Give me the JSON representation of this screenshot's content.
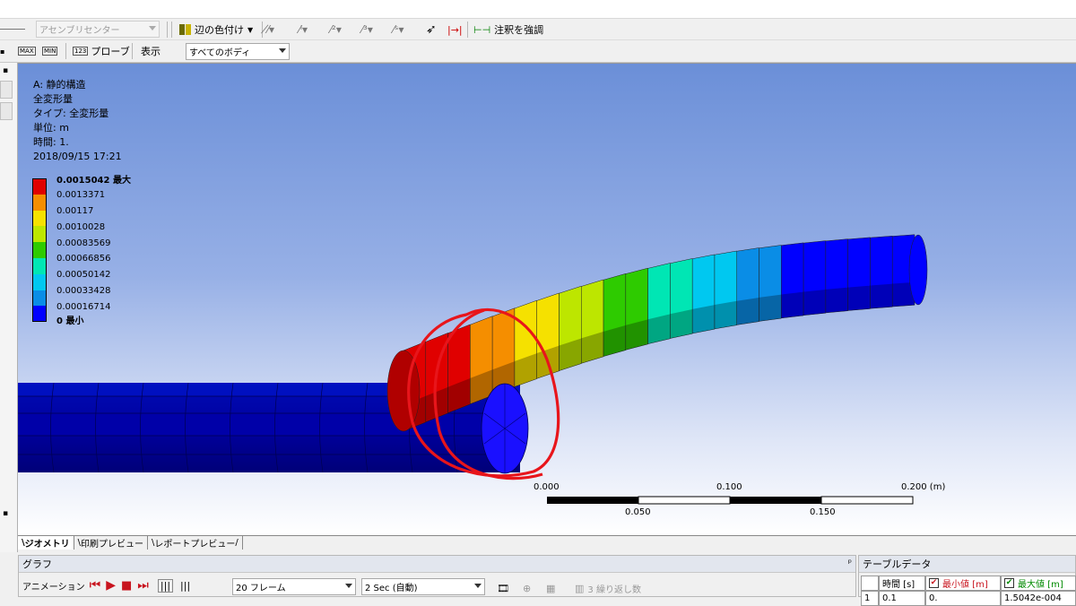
{
  "toolbar1": {
    "assembly_center": "アセンブリセンター",
    "edge_color": "辺の色付け",
    "annotation_emphasis": "注釈を強調"
  },
  "toolbar2": {
    "max_label": "MAX",
    "min_label": "MIN",
    "probe": "プローブ",
    "display": "表示",
    "body_select": "すべてのボディ"
  },
  "result_info": {
    "line1": "A: 静的構造",
    "line2": "全変形量",
    "line3": "タイプ: 全変形量",
    "line4": "単位: m",
    "line5": "時間: 1.",
    "line6": "2018/09/15 17:21"
  },
  "legend": {
    "colors": [
      "#e00000",
      "#f58e00",
      "#f5e100",
      "#bde600",
      "#2ecb00",
      "#00e6b4",
      "#00c8f0",
      "#0a8de6",
      "#0000ff"
    ],
    "labels": [
      "0.0015042 最大",
      "0.0013371",
      "0.00117",
      "0.0010028",
      "0.00083569",
      "0.00066856",
      "0.00050142",
      "0.00033428",
      "0.00016714",
      "0 最小"
    ]
  },
  "scale_bar": {
    "top_labels": [
      "0.000",
      "0.100",
      "0.200 (m)"
    ],
    "bottom_labels": [
      "0.050",
      "0.150"
    ]
  },
  "tabs": [
    "ジオメトリ",
    "印刷プレビュー",
    "レポートプレビュー"
  ],
  "graph": {
    "title": "グラフ",
    "animation": "アニメーション",
    "frames": "20 フレーム",
    "duration": "2 Sec (自動)",
    "repeat": "3 繰り返し数"
  },
  "table": {
    "title": "テーブルデータ",
    "col_time": "時間 [s]",
    "col_min": "最小値 [m]",
    "col_max": "最大値 [m]",
    "row1_index": "1",
    "row1_time": "0.1",
    "row1_min": "0.",
    "row1_max": "1.5042e-004"
  }
}
